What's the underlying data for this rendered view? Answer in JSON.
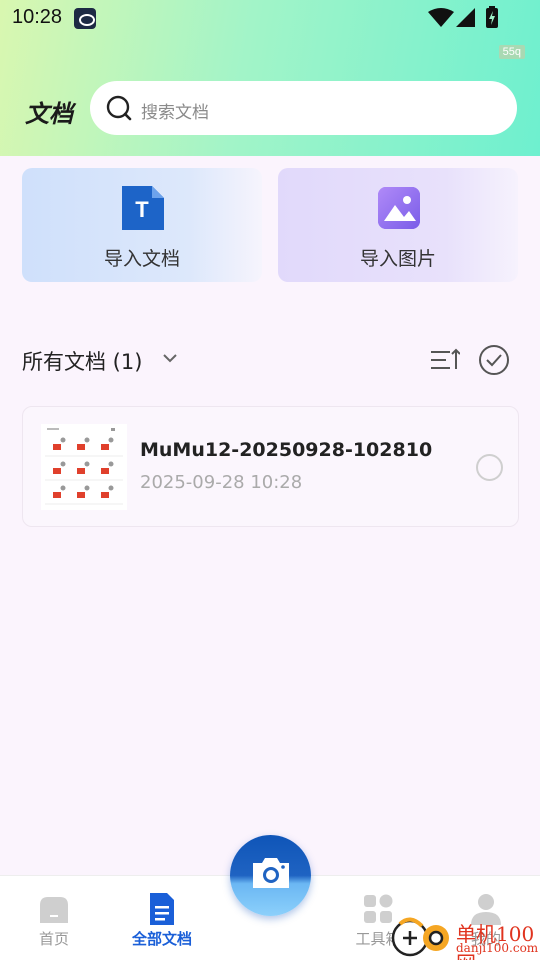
{
  "status_bar": {
    "time": "10:28",
    "icons": [
      "notification-icon",
      "wifi-icon",
      "signal-icon",
      "battery-icon"
    ],
    "fps_badge": "55q"
  },
  "header": {
    "title": "文档",
    "search": {
      "placeholder": "搜索文档",
      "icon": "search-icon"
    }
  },
  "import_cards": [
    {
      "label": "导入文档",
      "icon": "word-doc-icon",
      "color": "#1d64c8"
    },
    {
      "label": "导入图片",
      "icon": "image-icon",
      "color": "#8f6df0"
    }
  ],
  "section": {
    "title": "所有文档 (1)",
    "icons": [
      "chevron-down-icon",
      "sort-icon",
      "select-all-icon"
    ]
  },
  "documents": [
    {
      "name": "MuMu12-20250928-102810",
      "date": "2025-09-28 10:28",
      "selected": false
    }
  ],
  "bottom_nav": {
    "items": [
      {
        "label": "首页",
        "icon": "home-icon",
        "active": false
      },
      {
        "label": "全部文档",
        "icon": "document-list-icon",
        "active": true
      },
      {
        "label": "工具箱",
        "icon": "toolbox-icon",
        "active": false
      },
      {
        "label": "我的",
        "icon": "profile-icon",
        "active": false
      }
    ],
    "camera_icon": "camera-icon",
    "active_color": "#1a5fd8"
  },
  "watermark": {
    "text": "单机100网",
    "sub": "danji100.com"
  }
}
